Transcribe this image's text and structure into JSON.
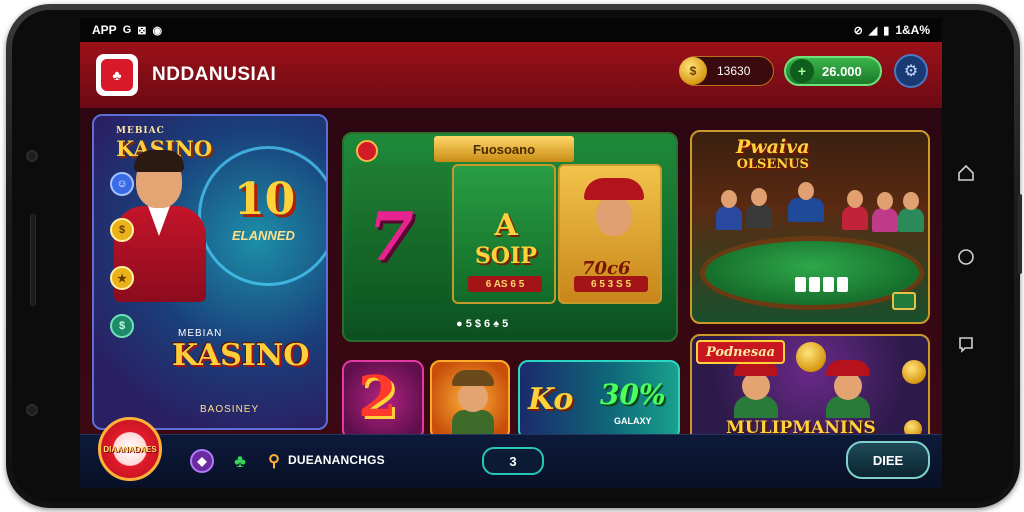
{
  "status_bar": {
    "left_text": "APP",
    "left_icons": [
      "G",
      "⊠",
      "◉"
    ],
    "right_text": "1&A%"
  },
  "header": {
    "app_name": "NDDANUSIAI",
    "coins": "13630",
    "cash": "26.000",
    "coin_icon_label": "$"
  },
  "banner": {
    "top_small": "MEBIAC",
    "top_title": "KASINO",
    "number": "10",
    "subtitle": "ELANNED",
    "kasino_small": "MEBIAN",
    "kasino": "KASINO",
    "bottom": "BAOSINEY",
    "chips": [
      "☺",
      "$",
      "★",
      "$"
    ]
  },
  "slot": {
    "ribbon": "Fuosoano",
    "reel_mid_a": "A",
    "reel_mid_b": "SOIP",
    "reel3_num": "70c6",
    "reel_label_left": "6 AS 6 5",
    "reel_label_right": "6 5 3 S 5",
    "controls": "● 5 $ 6 ♠ 5"
  },
  "poker": {
    "title": "Pwaiva",
    "subtitle": "OLSENUS"
  },
  "small_tiles": {
    "tile1_number": "2",
    "tile3_a": "Ko",
    "tile3_b": "30%",
    "tile3_sub": "GALAXY"
  },
  "multiplayer": {
    "badge": "Podnesaa",
    "title": "MULIPMANINS"
  },
  "bottom_bar": {
    "logo_text": "DIAANADAES",
    "text": "DUEANANCHGS",
    "mid_button": "3",
    "right_button": "DIEE"
  },
  "colors": {
    "accent_red": "#9b1119",
    "accent_green": "#39b54a",
    "gold": "#ffd23a"
  }
}
